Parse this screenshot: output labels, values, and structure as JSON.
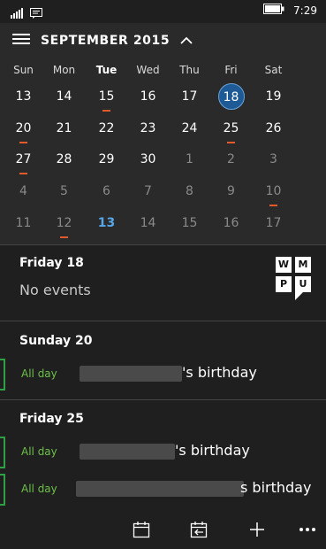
{
  "status": {
    "time": "7:29"
  },
  "calendar": {
    "month_title": "SEPTEMBER 2015",
    "weekdays": [
      "Sun",
      "Mon",
      "Tue",
      "Wed",
      "Thu",
      "Fri",
      "Sat"
    ],
    "weeks": [
      [
        "13",
        "14",
        "15",
        "16",
        "17",
        "18",
        "19"
      ],
      [
        "20",
        "21",
        "22",
        "23",
        "24",
        "25",
        "26"
      ],
      [
        "27",
        "28",
        "29",
        "30",
        "1",
        "2",
        "3"
      ],
      [
        "4",
        "5",
        "6",
        "7",
        "8",
        "9",
        "10"
      ],
      [
        "11",
        "12",
        "13",
        "14",
        "15",
        "16",
        "17"
      ]
    ]
  },
  "agenda": {
    "friday18": {
      "title": "Friday 18",
      "empty": "No events"
    },
    "sunday20": {
      "title": "Sunday 20",
      "event1": {
        "allday": "All day",
        "text": "'s birthday"
      }
    },
    "friday25": {
      "title": "Friday 25",
      "event1": {
        "allday": "All day",
        "text": "'s birthday"
      },
      "event2": {
        "allday": "All day",
        "text": "s birthday"
      }
    }
  },
  "logo": {
    "letters": [
      "W",
      "M",
      "P",
      "U"
    ]
  },
  "icons": {
    "signal": "signal-icon",
    "message": "message-icon",
    "battery": "battery-icon",
    "menu": "hamburger-menu-icon",
    "chevron": "chevron-up-icon",
    "calendar": "calendar-icon",
    "today": "today-icon",
    "add": "add-icon",
    "more": "more-icon"
  },
  "colors": {
    "accent": "#1e5a96",
    "today": "#56a6e8",
    "event_dot": "#e05a2c",
    "allday": "#6cc04a"
  }
}
